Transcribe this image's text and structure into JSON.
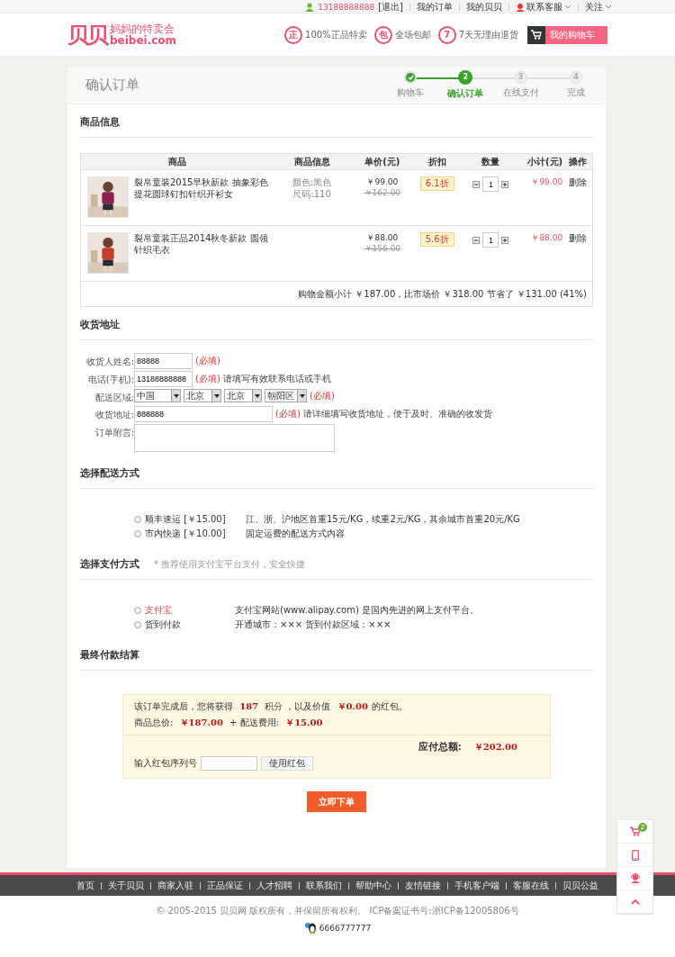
{
  "top_bar": {
    "phone": "13188888888",
    "links": [
      "[退出]",
      "我的订单",
      "我的贝贝",
      "联系客服",
      "关注"
    ]
  },
  "header": {
    "logo_mark": "贝贝",
    "tagline": "妈妈的特卖会",
    "domain": "beibei.com",
    "promises": [
      {
        "badge": "正",
        "text": "100%正品特卖"
      },
      {
        "badge": "包",
        "text": "全场包邮"
      },
      {
        "badge": "7",
        "text": "7天无理由退货"
      }
    ],
    "cart_button": "我的购物车"
  },
  "page_title": "确认订单",
  "steps": [
    {
      "label": "购物车",
      "completed": true,
      "selected": false
    },
    {
      "number": "2",
      "label": "确认订单",
      "completed": false,
      "selected": true
    },
    {
      "number": "3",
      "label": "在线支付",
      "completed": false,
      "selected": false
    },
    {
      "number": "4",
      "label": "完成",
      "completed": false,
      "selected": false
    }
  ],
  "products": {
    "title": "商品信息",
    "columns": [
      "商品",
      "商品信息",
      "单价(元)",
      "折扣",
      "数量",
      "小计(元)",
      "操作"
    ],
    "rows": [
      {
        "name": "裂帛童装2015早秋新款 抽象彩色提花圆球钉扣针织开衫女",
        "attributes": [
          "颜色:黑色",
          "尺码:110"
        ],
        "price": "￥99.00",
        "original_price": "￥162.00",
        "discount": "6.1折",
        "quantity": "1",
        "subtotal": "￥99.00",
        "action": "删除"
      },
      {
        "name": "裂帛童装正品2014秋冬新款 圆领针织毛衣",
        "price": "￥88.00",
        "original_price": "￥156.00",
        "discount": "5.6折",
        "quantity": "1",
        "subtotal": "￥88.00",
        "action": "删除"
      }
    ],
    "summary": "购物金额小计 ￥187.00，比市场价 ￥318.00 节省了 ￥131.00 (41%)"
  },
  "address": {
    "title": "收货地址",
    "fields": [
      {
        "kind": "text",
        "label": "收货人姓名:",
        "value": "88888",
        "required": "(必填)"
      },
      {
        "kind": "text",
        "label": "电话(手机):",
        "value": "13188888888",
        "required": "(必填)",
        "hint": "请填写有效联系电话或手机"
      },
      {
        "kind": "selects",
        "label": "配送区域:",
        "values": [
          "中国",
          "北京",
          "北京",
          "朝阳区"
        ],
        "required": "(必填)"
      },
      {
        "kind": "wide",
        "label": "收货地址:",
        "value": "888888",
        "required": "(必填)",
        "hint": "请详细填写收货地址，便于及时、准确的收发货"
      },
      {
        "kind": "textarea",
        "label": "订单附言:"
      }
    ]
  },
  "shipping": {
    "title": "选择配送方式",
    "options": [
      {
        "label": "顺丰速运 [￥15.00]",
        "selected": false,
        "description": "江、浙、沪地区首重15元/KG，续重2元/KG，其余城市首重20元/KG"
      },
      {
        "label": "市内快递 [￥10.00]",
        "selected": false,
        "description": "固定运费的配送方式内容"
      }
    ]
  },
  "payment": {
    "title": "选择支付方式",
    "note": "* 推荐使用支付宝平台支付，安全快捷",
    "options": [
      {
        "label": "支付宝",
        "selected": false,
        "highlighted": true,
        "description": "支付宝网站(www.alipay.com) 是国内先进的网上支付平台。"
      },
      {
        "label": "货到付款",
        "selected": false,
        "highlighted": false,
        "description": "开通城市：××× 货到付款区域：×××"
      }
    ]
  },
  "settlement": {
    "title": "最终付款结算",
    "points": "该订单完成后，您将获得 **187** 积分 ，以及价值 **￥0.00**的红包。",
    "totals": "商品总价: **￥187.00** + 配送费用: **￥15.00**",
    "total_label": "应付总额:",
    "total": "￥202.00",
    "coupon_label": "输入红包序列号",
    "coupon_button": "使用红包",
    "submit": "立即下单"
  },
  "footer": {
    "links": [
      "首页",
      "关于贝贝",
      "商家入驻",
      "正品保证",
      "人才招聘",
      "联系我们",
      "帮助中心",
      "友情链接",
      "手机客户端",
      "客服在线",
      "贝贝公益"
    ],
    "copyright": "© 2005-2015 贝贝网 版权所有，并保留所有权利。 ICP备案证书号:浙ICP备12005806号",
    "qq": "6666777777"
  },
  "side_tools": {
    "cart_count": "2"
  }
}
